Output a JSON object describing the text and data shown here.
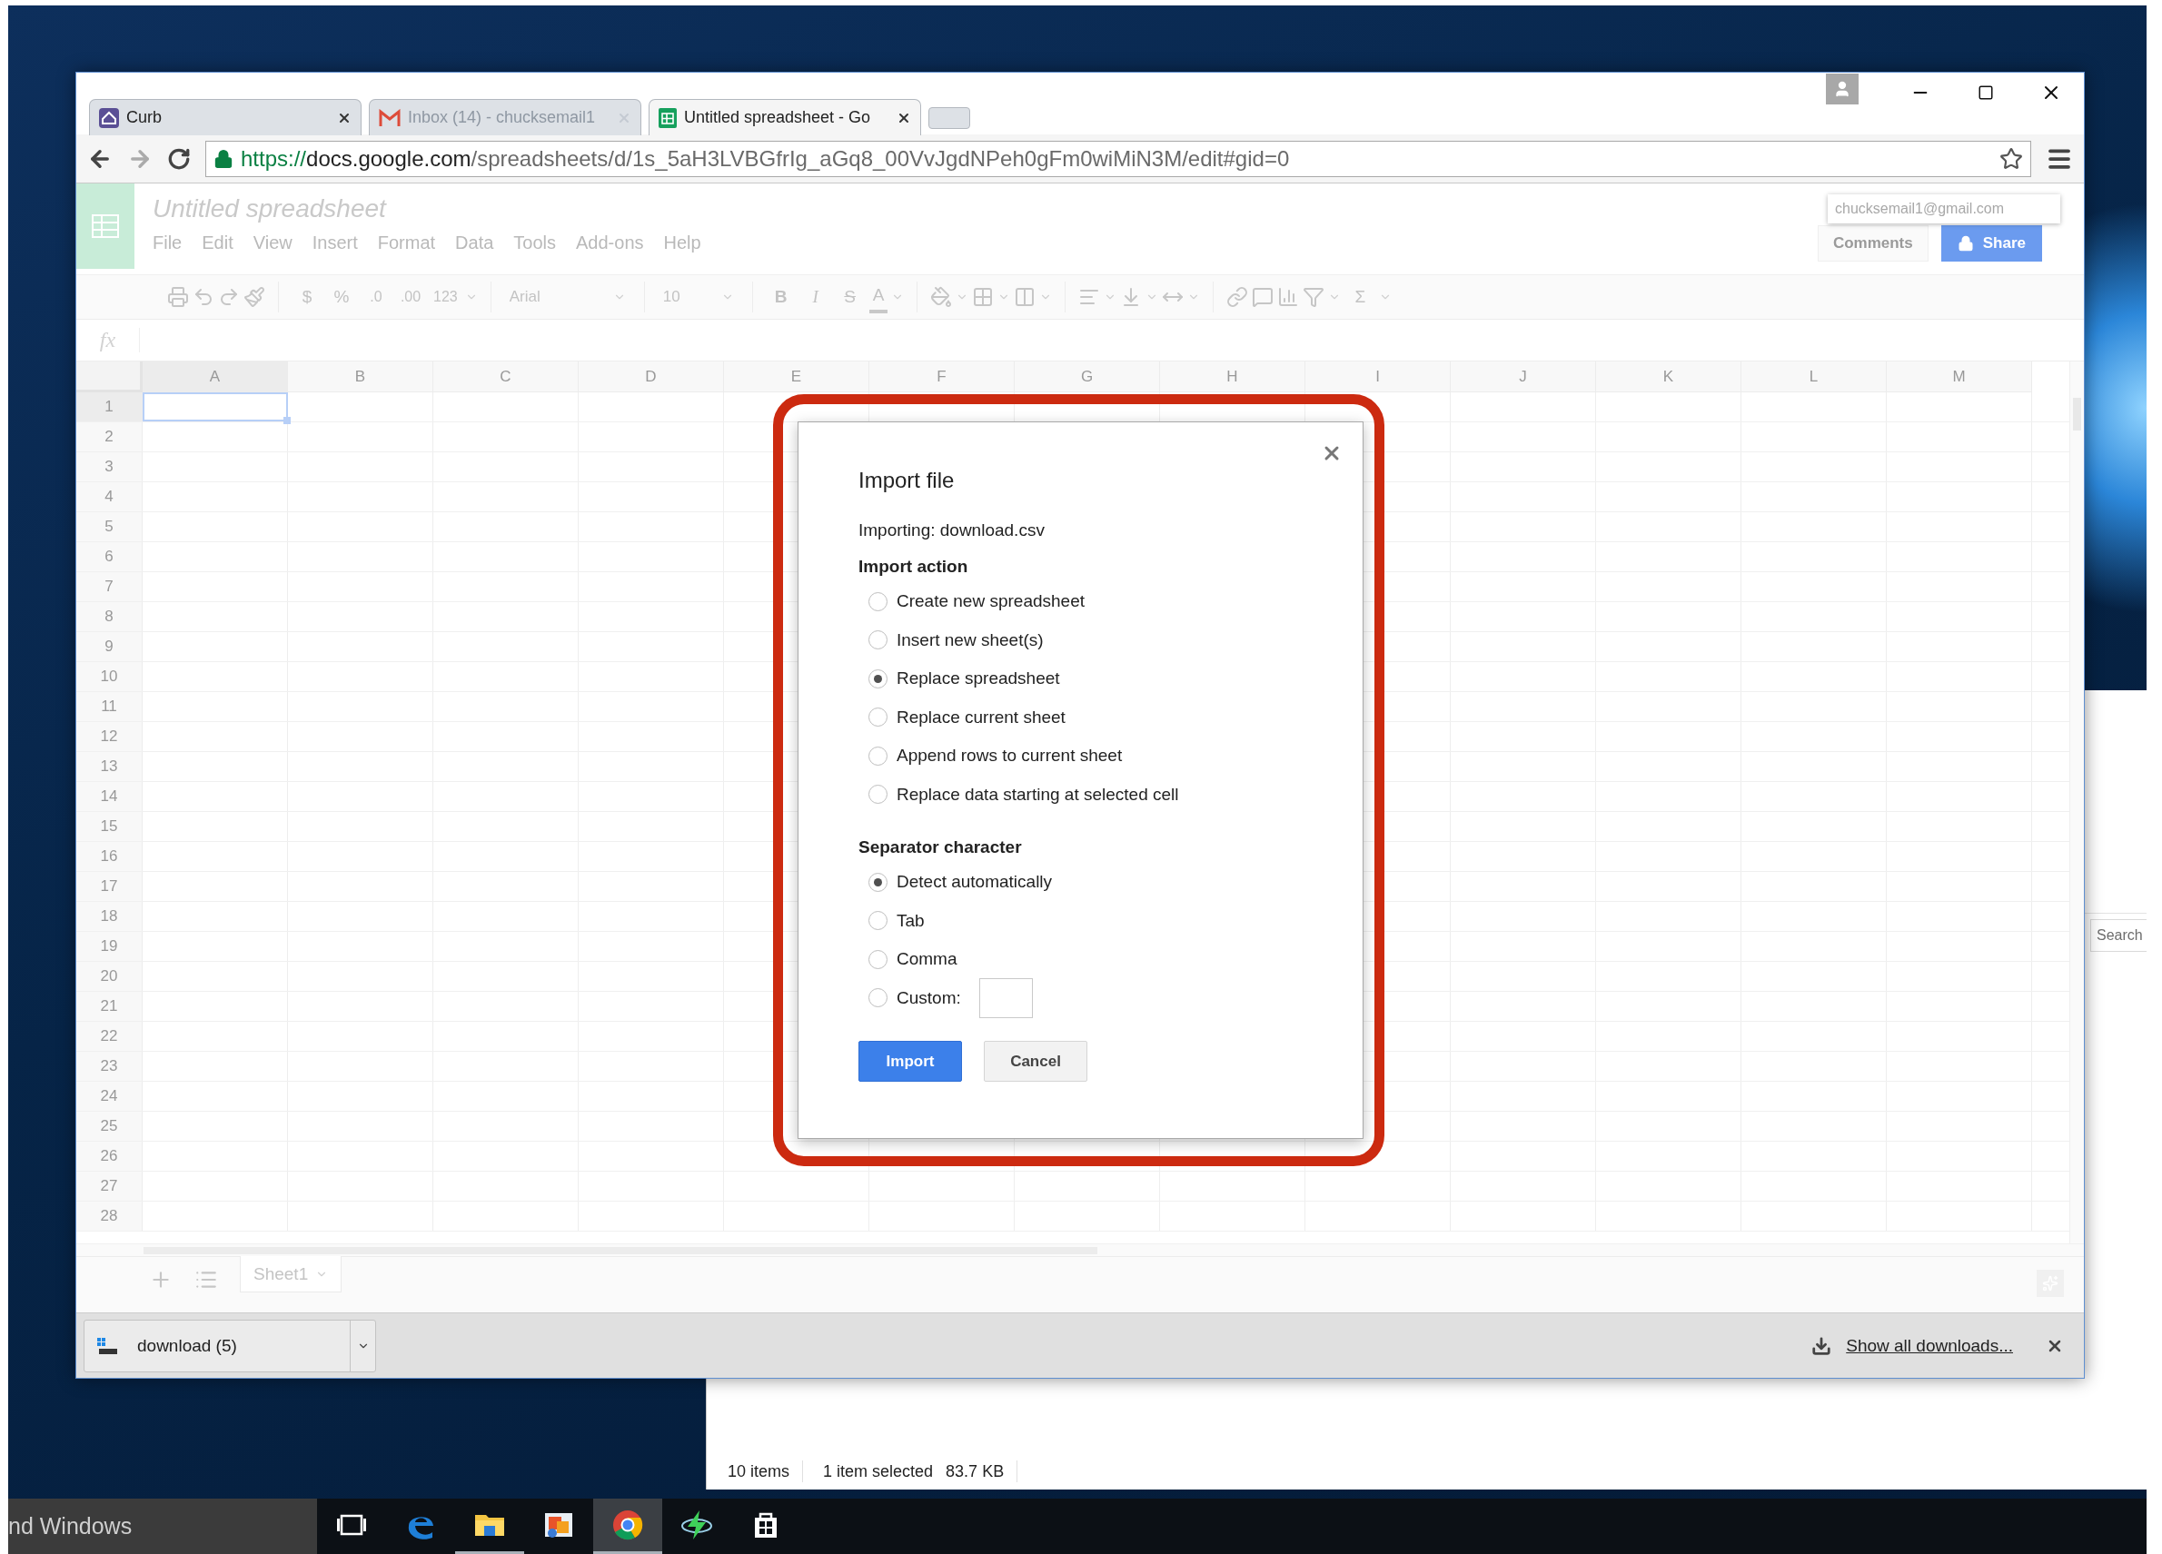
{
  "browser": {
    "tabs": [
      {
        "title": "Curb",
        "kind": "curb",
        "selected": false,
        "dimmed": false
      },
      {
        "title": "Inbox (14) - chucksemail1",
        "kind": "mail",
        "selected": false,
        "dimmed": true
      },
      {
        "title": "Untitled spreadsheet - Go",
        "kind": "sheet",
        "selected": true,
        "dimmed": false
      }
    ],
    "url": {
      "secure": true,
      "scheme": "https://",
      "host": "docs.google.com",
      "path": "/spreadsheets/d/1s_5aH3LVBGfrIg_aGq8_00VvJgdNPeh0gFm0wiMiN3M/edit#gid=0"
    }
  },
  "sheets": {
    "title": "Untitled spreadsheet",
    "account": "chucksemail1@gmail.com",
    "menu": [
      "File",
      "Edit",
      "View",
      "Insert",
      "Format",
      "Data",
      "Tools",
      "Add-ons",
      "Help"
    ],
    "comments": "Comments",
    "share": "Share",
    "toolbar": {
      "currency": "$",
      "percent": "%",
      "decimals_less": ".0",
      "decimals_more": ".00",
      "number_format": "123",
      "font": "Arial",
      "font_size": "10",
      "bold": "B",
      "italic": "I",
      "strike": "S",
      "text_color": "A",
      "functions": "Σ"
    },
    "formula_label": "fx",
    "columns": [
      {
        "label": "A",
        "selected": true
      },
      {
        "label": "B",
        "selected": false
      },
      {
        "label": "C",
        "selected": false
      },
      {
        "label": "D",
        "selected": false
      },
      {
        "label": "E",
        "selected": false
      },
      {
        "label": "F",
        "selected": false
      },
      {
        "label": "G",
        "selected": false
      },
      {
        "label": "H",
        "selected": false
      },
      {
        "label": "I",
        "selected": false
      },
      {
        "label": "J",
        "selected": false
      },
      {
        "label": "K",
        "selected": false
      },
      {
        "label": "L",
        "selected": false
      },
      {
        "label": "M",
        "selected": false
      }
    ],
    "rows": [
      {
        "label": "1",
        "selected": true
      },
      {
        "label": "2",
        "selected": false
      },
      {
        "label": "3",
        "selected": false
      },
      {
        "label": "4",
        "selected": false
      },
      {
        "label": "5",
        "selected": false
      },
      {
        "label": "6",
        "selected": false
      },
      {
        "label": "7",
        "selected": false
      },
      {
        "label": "8",
        "selected": false
      },
      {
        "label": "9",
        "selected": false
      },
      {
        "label": "10",
        "selected": false
      },
      {
        "label": "11",
        "selected": false
      },
      {
        "label": "12",
        "selected": false
      },
      {
        "label": "13",
        "selected": false
      },
      {
        "label": "14",
        "selected": false
      },
      {
        "label": "15",
        "selected": false
      },
      {
        "label": "16",
        "selected": false
      },
      {
        "label": "17",
        "selected": false
      },
      {
        "label": "18",
        "selected": false
      },
      {
        "label": "19",
        "selected": false
      },
      {
        "label": "20",
        "selected": false
      },
      {
        "label": "21",
        "selected": false
      },
      {
        "label": "22",
        "selected": false
      },
      {
        "label": "23",
        "selected": false
      },
      {
        "label": "24",
        "selected": false
      },
      {
        "label": "25",
        "selected": false
      },
      {
        "label": "26",
        "selected": false
      },
      {
        "label": "27",
        "selected": false
      },
      {
        "label": "28",
        "selected": false
      }
    ],
    "sheet_tabs": [
      {
        "label": "Sheet1",
        "selected": true
      }
    ]
  },
  "dialog": {
    "title": "Import file",
    "importing": "Importing: download.csv",
    "groups": [
      {
        "heading": "Import action",
        "options": [
          {
            "label": "Create new spreadsheet",
            "kind": "plain",
            "selected": false
          },
          {
            "label": "Insert new sheet(s)",
            "kind": "plain",
            "selected": false
          },
          {
            "label": "Replace spreadsheet",
            "kind": "plain",
            "selected": true
          },
          {
            "label": "Replace current sheet",
            "kind": "plain",
            "selected": false
          },
          {
            "label": "Append rows to current sheet",
            "kind": "plain",
            "selected": false
          },
          {
            "label": "Replace data starting at selected cell",
            "kind": "plain",
            "selected": false
          }
        ]
      },
      {
        "heading": "Separator character",
        "options": [
          {
            "label": "Detect automatically",
            "kind": "plain",
            "selected": true
          },
          {
            "label": "Tab",
            "kind": "plain",
            "selected": false
          },
          {
            "label": "Comma",
            "kind": "plain",
            "selected": false
          },
          {
            "label": "Custom:",
            "kind": "custom",
            "selected": false
          }
        ]
      }
    ],
    "buttons": [
      {
        "label": "Import",
        "kind": "primary"
      },
      {
        "label": "Cancel",
        "kind": "secondary"
      }
    ]
  },
  "downloads": {
    "items": [
      "download (5)"
    ],
    "show_all": "Show all downloads..."
  },
  "explorer": {
    "search_placeholder": "Search",
    "status": [
      "10 items",
      "1 item selected",
      "83.7 KB"
    ]
  },
  "taskbar": {
    "search_text": "nd Windows",
    "apps": [
      {
        "kind": "taskview",
        "running": false,
        "selected": false
      },
      {
        "kind": "edge",
        "running": false,
        "selected": false
      },
      {
        "kind": "files",
        "running": true,
        "selected": false
      },
      {
        "kind": "photos",
        "running": false,
        "selected": false
      },
      {
        "kind": "chrome",
        "running": true,
        "selected": true
      },
      {
        "kind": "bolt",
        "running": false,
        "selected": false
      },
      {
        "kind": "store",
        "running": false,
        "selected": false
      }
    ]
  }
}
